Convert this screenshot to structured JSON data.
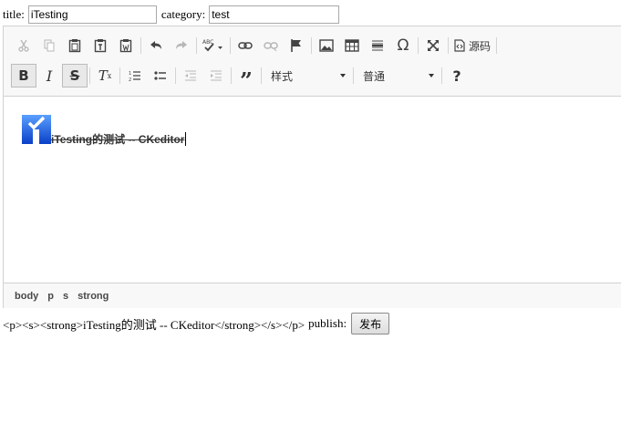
{
  "form": {
    "title_label": "title:",
    "title_value": "iTesting",
    "category_label": "category:",
    "category_value": "test"
  },
  "toolbar": {
    "row1": [
      "cut-icon",
      "copy-icon",
      "paste-icon",
      "paste-text-icon",
      "paste-word-icon",
      "undo-icon",
      "redo-icon",
      "spellcheck-icon",
      "link-icon",
      "unlink-icon",
      "anchor-icon",
      "image-icon",
      "table-icon",
      "horizontal-line-icon",
      "special-char-icon",
      "maximize-icon",
      "source-icon"
    ],
    "source_label": "源码",
    "row2": [
      "bold-icon",
      "italic-icon",
      "strike-icon",
      "remove-format-icon",
      "numbered-list-icon",
      "bulleted-list-icon",
      "outdent-icon",
      "indent-icon",
      "blockquote-icon"
    ],
    "styles_label": "样式",
    "format_label": "普通",
    "help_label": "?"
  },
  "editor": {
    "text": "iTesting的测试 -- CKeditor"
  },
  "pathbar": [
    "body",
    "p",
    "s",
    "strong"
  ],
  "source": {
    "html_text": "<p><s><strong>iTesting的测试 -- CKeditor</strong></s></p>",
    "publish_label": "publish:",
    "publish_button": "发布"
  },
  "colors": {
    "toolbar_bg": "#f8f8f8",
    "border": "#d1d1d1",
    "icon": "#444444",
    "icon_disabled": "#b7b7b7"
  }
}
